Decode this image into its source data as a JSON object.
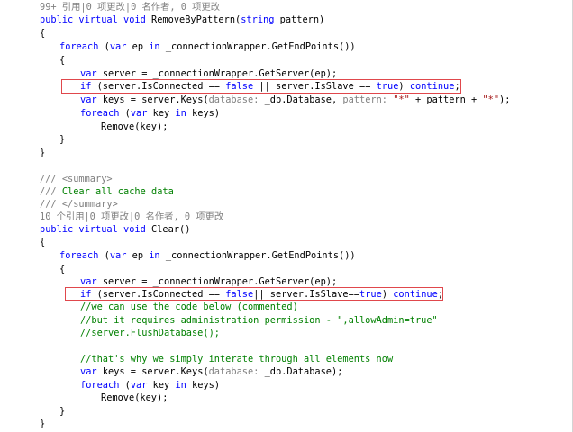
{
  "method1": {
    "codelens": "99+ 引用|0 项更改|0 名作者, 0 项更改",
    "kw_public": "public",
    "kw_virtual": "virtual",
    "kw_void": "void",
    "name": "RemoveByPattern",
    "paren_open": "(",
    "kw_string": "string",
    "param": "pattern",
    "paren_close": ")",
    "brace_open": "{",
    "brace_close": "}",
    "foreach_kw": "foreach",
    "foreach_open": "(",
    "foreach_var": "var",
    "foreach_ep": "ep",
    "foreach_in": "in",
    "foreach_expr": "_connectionWrapper.GetEndPoints())",
    "inner_open": "{",
    "inner_close": "}",
    "l1_var": "var",
    "l1_rest": "server = _connectionWrapper.GetServer(ep);",
    "l2_if": "if",
    "l2_a": "(server.IsConnected ==",
    "l2_false": "false",
    "l2_b": "|| server.IsSlave ==",
    "l2_true": "true",
    "l2_c": ")",
    "l2_continue": "continue",
    "l2_d": ";",
    "l3_var": "var",
    "l3_a": "keys = server.Keys(",
    "l3_hint_db": "database:",
    "l3_b": "_db.Database,",
    "l3_hint_pattern": "pattern:",
    "l3_str1": "\"*\"",
    "l3_c": "+ pattern +",
    "l3_str2": "\"*\"",
    "l3_d": ");",
    "l4_foreach": "foreach",
    "l4_a": "(",
    "l4_var": "var",
    "l4_b": "key",
    "l4_in": "in",
    "l4_c": "keys)",
    "l5": "Remove(key);"
  },
  "doc": {
    "d1_slashes": "///",
    "d1_tag": "<summary>",
    "d2_slashes": "///",
    "d2_text": "Clear all cache data",
    "d3_slashes": "///",
    "d3_tag": "</summary>"
  },
  "method2": {
    "codelens": "10 个引用|0 项更改|0 名作者, 0 项更改",
    "kw_public": "public",
    "kw_virtual": "virtual",
    "kw_void": "void",
    "name": "Clear()",
    "brace_open": "{",
    "brace_close": "}",
    "foreach_kw": "foreach",
    "foreach_open": "(",
    "foreach_var": "var",
    "foreach_ep": "ep",
    "foreach_in": "in",
    "foreach_expr": "_connectionWrapper.GetEndPoints())",
    "inner_open": "{",
    "inner_close": "}",
    "l1_var": "var",
    "l1_rest": "server = _connectionWrapper.GetServer(ep);",
    "l2_if": "if",
    "l2_a": "(server.IsConnected ==",
    "l2_false": "false",
    "l2_b": "|| server.IsSlave==",
    "l2_true": "true",
    "l2_c": ")",
    "l2_continue": "continue",
    "l2_d": ";",
    "c1": "//we can use the code below (commented)",
    "c2": "//but it requires administration permission - \",allowAdmin=true\"",
    "c3": "//server.FlushDatabase();",
    "c4": "//that's why we simply interate through all elements now",
    "l3_var": "var",
    "l3_a": "keys = server.Keys(",
    "l3_hint_db": "database:",
    "l3_b": "_db.Database);",
    "l4_foreach": "foreach",
    "l4_a": "(",
    "l4_var": "var",
    "l4_b": "key",
    "l4_in": "in",
    "l4_c": "keys)",
    "l5": "Remove(key);"
  },
  "colors": {
    "keyword": "#0000ff",
    "comment": "#008000",
    "string": "#a31515",
    "hint": "#808080",
    "highlight_box": "#e0474c"
  }
}
